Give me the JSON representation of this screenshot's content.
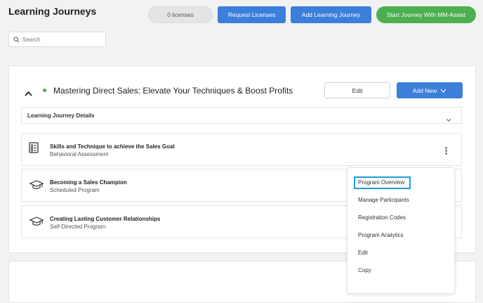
{
  "page_title": "Learning Journeys",
  "header": {
    "licenses_label": "0 licenses",
    "request_licenses_label": "Request Licenses",
    "add_learning_journey_label": "Add Learning Journey",
    "start_journey_label": "Start Journey With MM-Assist"
  },
  "search": {
    "placeholder": "Search",
    "value": ""
  },
  "journey": {
    "title": "Mastering Direct Sales: Elevate Your Techniques & Boost Profits",
    "status_color": "#4caf50",
    "edit_label": "Edit",
    "add_new_label": "Add New",
    "details_label": "Learning Journey Details"
  },
  "items": [
    {
      "title": "Skills and Technique to achieve the Sales Goal",
      "subtitle": "Behavioral Assessment",
      "icon": "checklist-icon"
    },
    {
      "title": "Becoming a Sales Champion",
      "subtitle": "Scheduled Program",
      "icon": "graduation-cap-icon"
    },
    {
      "title": "Creating Lasting Customer Relationships",
      "subtitle": "Self-Directed Program",
      "icon": "graduation-cap-icon"
    }
  ],
  "menu": {
    "items": [
      "Program Overview",
      "Manage Participants",
      "Registration Codes",
      "Program Analytics",
      "Edit",
      "Copy"
    ],
    "highlighted": "Program Overview"
  },
  "colors": {
    "primary_blue": "#3b7fdb",
    "green": "#4caf50",
    "highlight_border": "#1e9bd7"
  }
}
